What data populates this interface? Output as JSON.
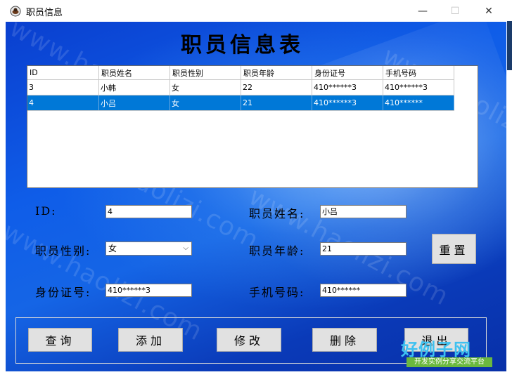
{
  "window": {
    "title": "职员信息",
    "min_glyph": "—",
    "max_glyph": "☐",
    "close_glyph": "✕"
  },
  "form": {
    "heading": "职员信息表"
  },
  "grid": {
    "columns": [
      "ID",
      "职员姓名",
      "职员性别",
      "职员年龄",
      "身份证号",
      "手机号码"
    ],
    "rows": [
      [
        "3",
        "小韩",
        "女",
        "22",
        "410******3",
        "410******3"
      ],
      [
        "4",
        "小吕",
        "女",
        "21",
        "410******3",
        "410******"
      ]
    ],
    "selected_row": 1
  },
  "fields": {
    "id_label": "ID:",
    "id_value": "4",
    "name_label": "职员姓名:",
    "name_value": "小吕",
    "gender_label": "职员性别:",
    "gender_value": "女",
    "age_label": "职员年龄:",
    "age_value": "21",
    "idcard_label": "身份证号:",
    "idcard_value": "410******3",
    "phone_label": "手机号码:",
    "phone_value": "410******"
  },
  "buttons": {
    "reset": "重置",
    "query": "查询",
    "add": "添加",
    "edit": "修改",
    "delete": "删除",
    "exit": "退出"
  },
  "watermark": "www.haolizi.com",
  "logo": {
    "main": "好例子网",
    "sub": "开发实例分享交流平台"
  },
  "colors": {
    "selection": "#0078d7",
    "background_blue": "#1565e6"
  }
}
